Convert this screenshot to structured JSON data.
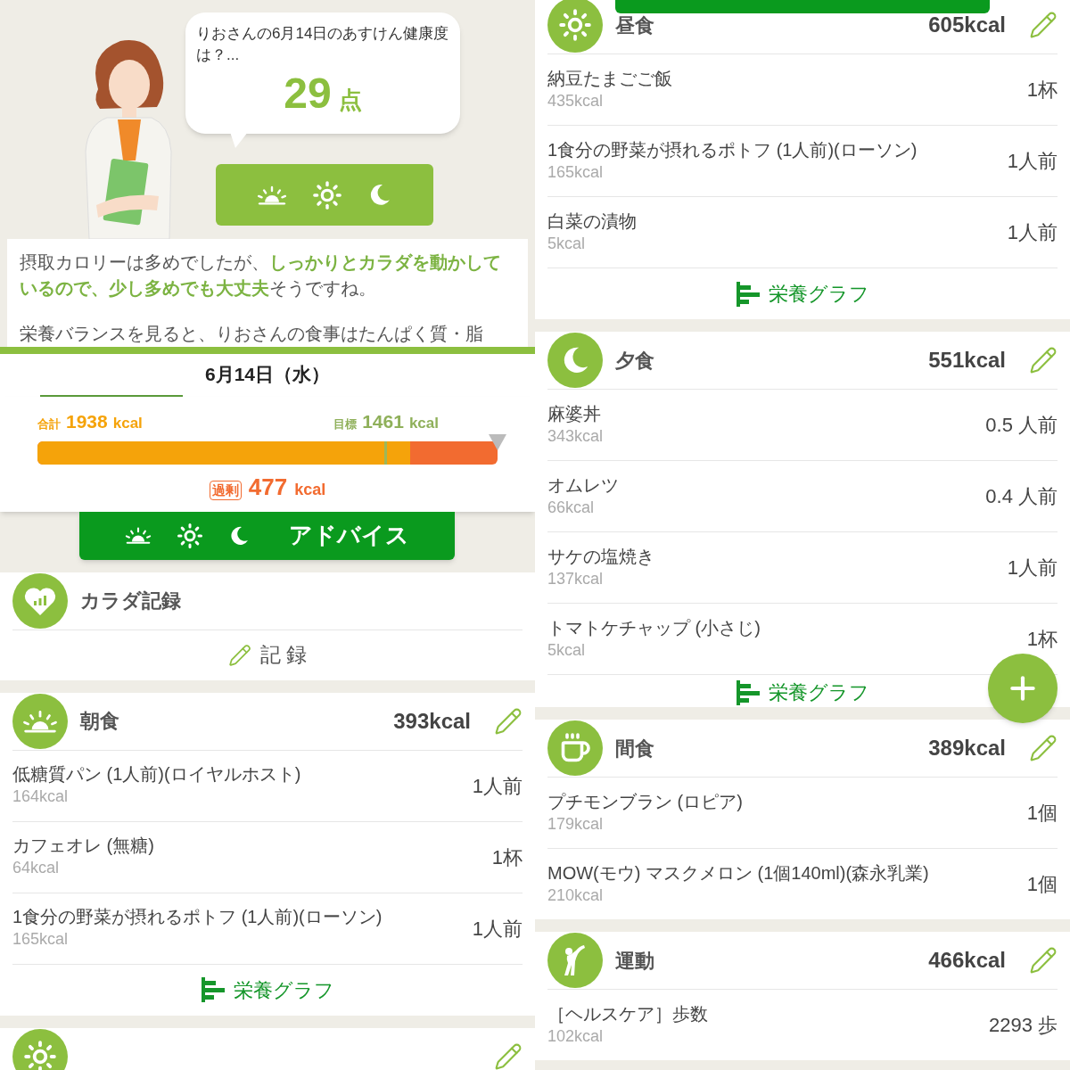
{
  "left_panel": {
    "assistant": {
      "question": "りおさんの6月14日のあすけん健康度は？...",
      "score": "29",
      "score_unit": "点"
    },
    "meal_time_button": {
      "icons": [
        {
          "kind": "breakfast"
        },
        {
          "kind": "lunch"
        },
        {
          "kind": "dinner"
        }
      ]
    },
    "advice": [
      "摂取カロリーは多めでしたが、**しっかりとカラダを動かしているので、少し多めでも大丈夫**そうですね。",
      "栄養バランスを見ると、りおさんの食事はたんぱく質・脂"
    ],
    "date": "6月14日（水）",
    "calories": {
      "total_label": "合計",
      "total": "1938",
      "total_unit": "kcal",
      "target_label": "目標",
      "target": "1461",
      "target_unit": "kcal",
      "level": 0.81,
      "excess_label": "過剰",
      "excess": "477",
      "excess_unit": "kcal"
    },
    "advice_button": {
      "icons": [
        {
          "kind": "breakfast"
        },
        {
          "kind": "lunch"
        },
        {
          "kind": "dinner"
        }
      ],
      "label": "アドバイス"
    },
    "body_record": {
      "title": "カラダ記録",
      "action": "記 録"
    },
    "sections": [
      {
        "kind": "breakfast",
        "title": "朝食",
        "kcal": "393kcal",
        "items": [
          {
            "name": "低糖質パン (1人前)(ロイヤルホスト)",
            "kcal": "164kcal",
            "amount": "1人前"
          },
          {
            "name": "カフェオレ (無糖)",
            "kcal": "64kcal",
            "amount": "1杯"
          },
          {
            "name": "1食分の野菜が摂れるポトフ (1人前)(ローソン)",
            "kcal": "165kcal",
            "amount": "1人前"
          }
        ],
        "graph_link": "栄養グラフ"
      },
      {
        "kind": "lunch"
      }
    ]
  },
  "right_panel": {
    "sections": [
      {
        "kind": "lunch",
        "title": "昼食",
        "kcal": "605kcal",
        "items": [
          {
            "name": "納豆たまごご飯",
            "kcal": "435kcal",
            "amount": "1杯"
          },
          {
            "name": "1食分の野菜が摂れるポトフ (1人前)(ローソン)",
            "kcal": "165kcal",
            "amount": "1人前"
          },
          {
            "name": "白菜の漬物",
            "kcal": "5kcal",
            "amount": "1人前"
          }
        ],
        "graph_link": "栄養グラフ"
      },
      {
        "kind": "dinner",
        "title": "夕食",
        "kcal": "551kcal",
        "items": [
          {
            "name": "麻婆丼",
            "kcal": "343kcal",
            "amount": "0.5 人前"
          },
          {
            "name": "オムレツ",
            "kcal": "66kcal",
            "amount": "0.4 人前"
          },
          {
            "name": "サケの塩焼き",
            "kcal": "137kcal",
            "amount": "1人前"
          },
          {
            "name": "トマトケチャップ (小さじ)",
            "kcal": "5kcal",
            "amount": "1杯"
          }
        ],
        "graph_link": "栄養グラフ"
      },
      {
        "kind": "snack",
        "title": "間食",
        "kcal": "389kcal",
        "items": [
          {
            "name": "プチモンブラン (ロピア)",
            "kcal": "179kcal",
            "amount": "1個"
          },
          {
            "name": "MOW(モウ) マスクメロン (1個140ml)(森永乳業)",
            "kcal": "210kcal",
            "amount": "1個"
          }
        ]
      },
      {
        "kind": "exercise",
        "title": "運動",
        "kcal": "466kcal",
        "items": [
          {
            "name": "［ヘルスケア］歩数",
            "kcal": "102kcal",
            "amount": "2293 歩"
          }
        ]
      }
    ]
  }
}
